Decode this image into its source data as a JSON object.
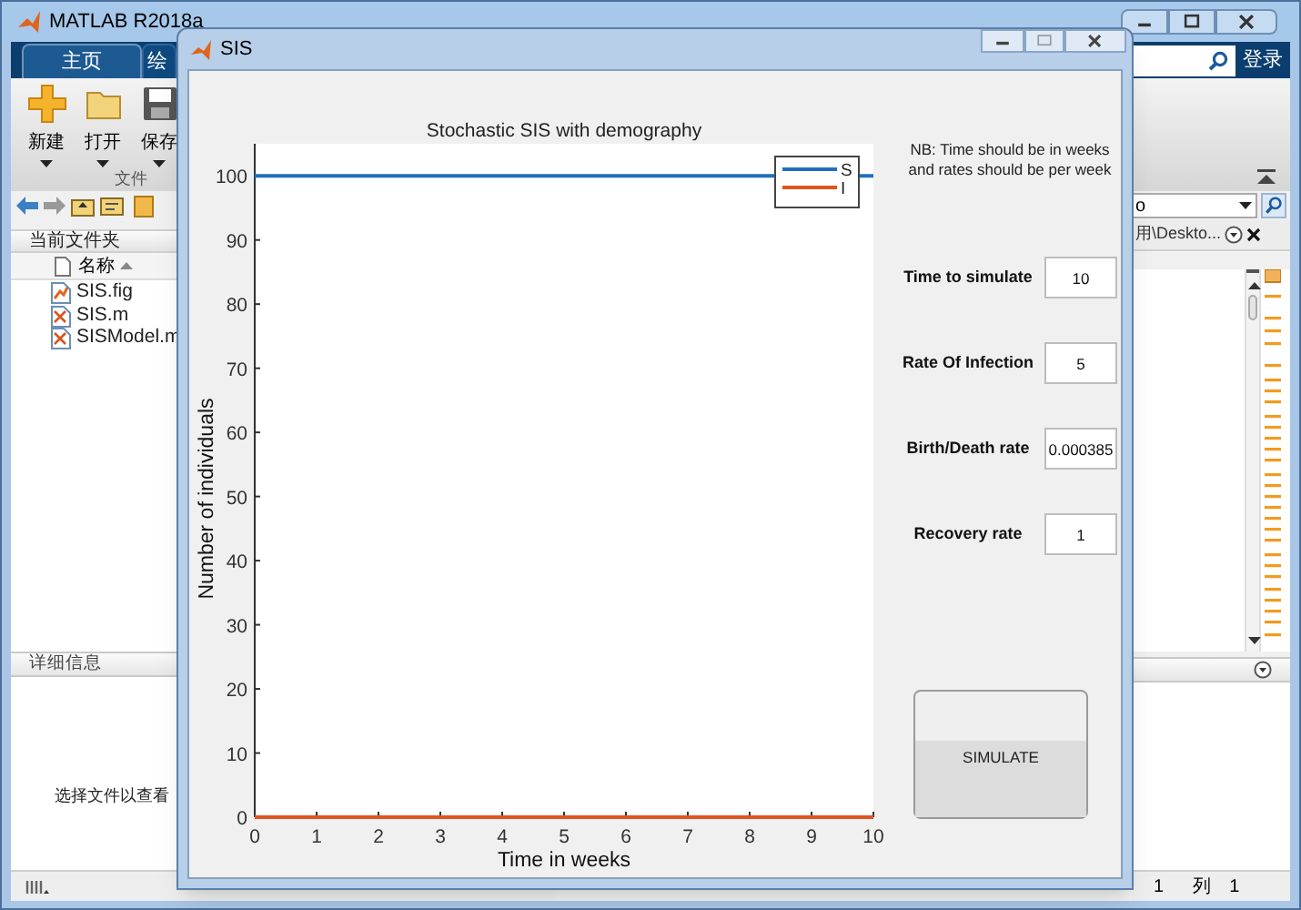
{
  "matlab_window": {
    "title": "MATLAB R2018a",
    "tabs": [
      {
        "label": "主页",
        "selected": true
      },
      {
        "label": "绘",
        "selected": false
      }
    ],
    "sign_in": "登录",
    "toolstrip": {
      "buttons": [
        {
          "label": "新建",
          "kind": "new"
        },
        {
          "label": "打开",
          "kind": "open"
        },
        {
          "label": "保存",
          "kind": "save"
        }
      ],
      "section": "文件"
    },
    "current_folder": {
      "title": "当前文件夹",
      "column": "名称",
      "files": [
        {
          "name": "SIS.fig",
          "kind": "fig"
        },
        {
          "name": "SIS.m",
          "kind": "m"
        },
        {
          "name": "SISModel.m",
          "kind": "m"
        }
      ]
    },
    "details": {
      "title": "详细信息",
      "message": "选择文件以查看"
    },
    "address": "o",
    "path": "用\\Deskto...",
    "status_bar": {
      "line": "1",
      "column_label": "列",
      "column": "1"
    }
  },
  "sis_window": {
    "title": "SIS",
    "chart": {
      "chart_data": {
        "type": "line",
        "title": "Stochastic SIS with demography",
        "xlabel": "Time in weeks",
        "ylabel": "Number of individuals",
        "x": [
          0,
          10
        ],
        "series": [
          {
            "name": "S",
            "color": "#1f6fbf",
            "values": [
              100,
              100
            ]
          },
          {
            "name": "I",
            "color": "#e0541e",
            "values": [
              0,
              0
            ]
          }
        ],
        "legend": "upper right",
        "xlim": [
          0,
          10
        ],
        "ylim": [
          0,
          105
        ],
        "xticks": [
          0,
          1,
          2,
          3,
          4,
          5,
          6,
          7,
          8,
          9,
          10
        ],
        "yticks": [
          0,
          10,
          20,
          30,
          40,
          50,
          60,
          70,
          80,
          90,
          100
        ]
      }
    },
    "note": "NB: Time should be in weeks\nand rates should be per week",
    "params": [
      {
        "label": "Time to simulate",
        "value": "10"
      },
      {
        "label": "Rate Of Infection",
        "value": "5"
      },
      {
        "label": "Birth/Death rate",
        "value": "0.000385"
      },
      {
        "label": "Recovery rate",
        "value": "1"
      }
    ],
    "button": "SIMULATE"
  }
}
